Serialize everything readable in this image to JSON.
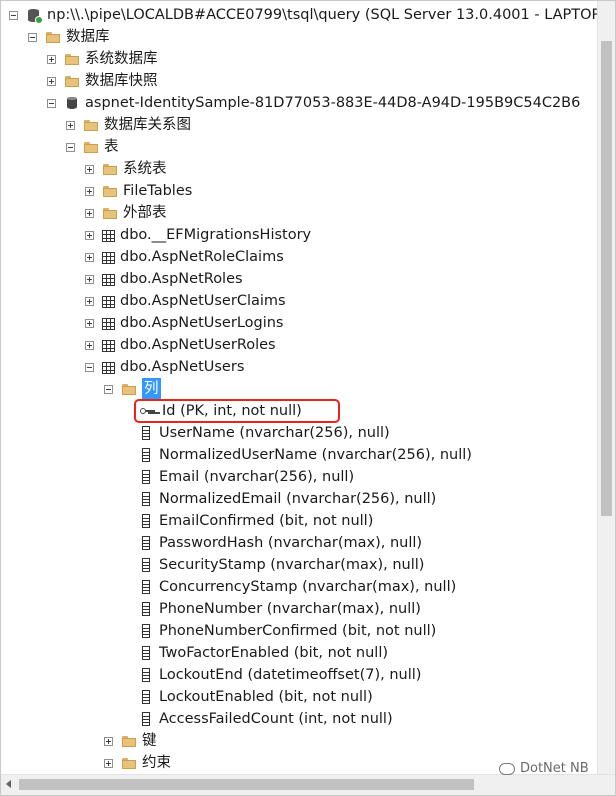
{
  "server": {
    "label": "np:\\\\.\\pipe\\LOCALDB#ACCE0799\\tsql\\query (SQL Server 13.0.4001 - LAPTOP"
  },
  "databases": {
    "label": "数据库"
  },
  "system_databases": {
    "label": "系统数据库"
  },
  "snapshots": {
    "label": "数据库快照"
  },
  "database": {
    "label": "aspnet-IdentitySample-81D77053-883E-44D8-A94D-195B9C54C2B6"
  },
  "diagrams": {
    "label": "数据库关系图"
  },
  "tables": {
    "label": "表"
  },
  "system_tables": {
    "label": "系统表"
  },
  "filetables": {
    "label": "FileTables"
  },
  "external_tables": {
    "label": "外部表"
  },
  "table_list": [
    "dbo.__EFMigrationsHistory",
    "dbo.AspNetRoleClaims",
    "dbo.AspNetRoles",
    "dbo.AspNetUserClaims",
    "dbo.AspNetUserLogins",
    "dbo.AspNetUserRoles",
    "dbo.AspNetUsers"
  ],
  "columns_folder": {
    "label": "列"
  },
  "columns": [
    "Id (PK, int, not null)",
    "UserName (nvarchar(256), null)",
    "NormalizedUserName (nvarchar(256), null)",
    "Email (nvarchar(256), null)",
    "NormalizedEmail (nvarchar(256), null)",
    "EmailConfirmed (bit, not null)",
    "PasswordHash (nvarchar(max), null)",
    "SecurityStamp (nvarchar(max), null)",
    "ConcurrencyStamp (nvarchar(max), null)",
    "PhoneNumber (nvarchar(max), null)",
    "PhoneNumberConfirmed (bit, not null)",
    "TwoFactorEnabled (bit, not null)",
    "LockoutEnd (datetimeoffset(7), null)",
    "LockoutEnabled (bit, not null)",
    "AccessFailedCount (int, not null)"
  ],
  "keys_folder": {
    "label": "键"
  },
  "constraints_folder": {
    "label": "约束"
  },
  "watermark": {
    "text": "DotNet NB"
  },
  "colors": {
    "selection": "#3399ff",
    "highlight_box": "#e8251c"
  }
}
